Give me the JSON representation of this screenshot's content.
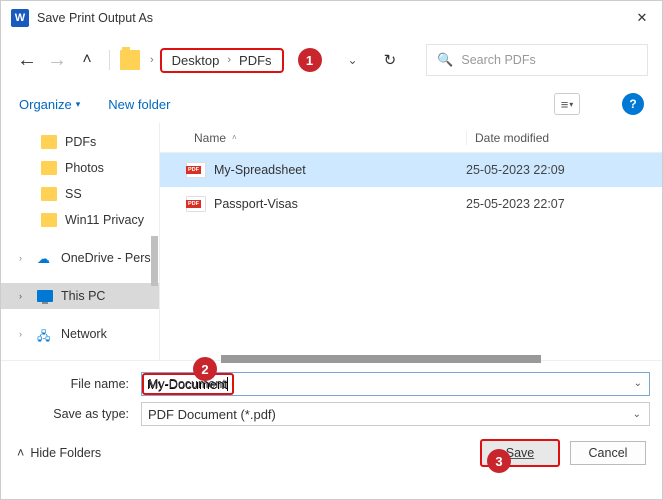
{
  "window": {
    "title": "Save Print Output As"
  },
  "breadcrumb": {
    "part1": "Desktop",
    "part2": "PDFs"
  },
  "search": {
    "placeholder": "Search PDFs"
  },
  "toolbar": {
    "organize": "Organize",
    "newfolder": "New folder"
  },
  "sidebar": {
    "items": [
      {
        "label": "PDFs"
      },
      {
        "label": "Photos"
      },
      {
        "label": "SS"
      },
      {
        "label": "Win11 Privacy"
      },
      {
        "label": "OneDrive - Perso"
      },
      {
        "label": "This PC"
      },
      {
        "label": "Network"
      }
    ]
  },
  "columns": {
    "name": "Name",
    "date": "Date modified"
  },
  "files": [
    {
      "name": "My-Spreadsheet",
      "date": "25-05-2023 22:09"
    },
    {
      "name": "Passport-Visas",
      "date": "25-05-2023 22:07"
    }
  ],
  "form": {
    "filename_label": "File name:",
    "filename_value": "My-Document",
    "type_label": "Save as type:",
    "type_value": "PDF Document (*.pdf)"
  },
  "footer": {
    "hide_folders": "Hide Folders",
    "save": "Save",
    "cancel": "Cancel"
  },
  "callouts": {
    "c1": "1",
    "c2": "2",
    "c3": "3"
  }
}
